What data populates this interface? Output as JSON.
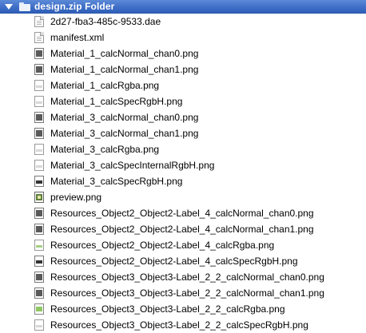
{
  "header": {
    "title": "design.zip Folder"
  },
  "files": [
    {
      "name": "2d27-fba3-485c-9533.dae",
      "icon": "document-icon"
    },
    {
      "name": "manifest.xml",
      "icon": "document-icon"
    },
    {
      "name": "Material_1_calcNormal_chan0.png",
      "icon": "image-dark-icon"
    },
    {
      "name": "Material_1_calcNormal_chan1.png",
      "icon": "image-dark-icon"
    },
    {
      "name": "Material_1_calcRgba.png",
      "icon": "image-light-icon"
    },
    {
      "name": "Material_1_calcSpecRgbH.png",
      "icon": "image-light-icon"
    },
    {
      "name": "Material_3_calcNormal_chan0.png",
      "icon": "image-dark-icon"
    },
    {
      "name": "Material_3_calcNormal_chan1.png",
      "icon": "image-dark-icon"
    },
    {
      "name": "Material_3_calcRgba.png",
      "icon": "image-light-icon"
    },
    {
      "name": "Material_3_calcSpecInternalRgbH.png",
      "icon": "image-light-icon"
    },
    {
      "name": "Material_3_calcSpecRgbH.png",
      "icon": "image-spec-icon"
    },
    {
      "name": "preview.png",
      "icon": "image-preview-icon"
    },
    {
      "name": "Resources_Object2_Object2-Label_4_calcNormal_chan0.png",
      "icon": "image-dark-icon"
    },
    {
      "name": "Resources_Object2_Object2-Label_4_calcNormal_chan1.png",
      "icon": "image-dark-icon"
    },
    {
      "name": "Resources_Object2_Object2-Label_4_calcRgba.png",
      "icon": "image-green-small-icon"
    },
    {
      "name": "Resources_Object2_Object2-Label_4_calcSpecRgbH.png",
      "icon": "image-spec-icon"
    },
    {
      "name": "Resources_Object3_Object3-Label_2_2_calcNormal_chan0.png",
      "icon": "image-dark-icon"
    },
    {
      "name": "Resources_Object3_Object3-Label_2_2_calcNormal_chan1.png",
      "icon": "image-dark-icon"
    },
    {
      "name": "Resources_Object3_Object3-Label_2_2_calcRgba.png",
      "icon": "image-green-icon"
    },
    {
      "name": "Resources_Object3_Object3-Label_2_2_calcSpecRgbH.png",
      "icon": "image-light-icon"
    }
  ],
  "colors": {
    "header_bg": "#3f6fc7",
    "header_text": "#ffffff"
  }
}
